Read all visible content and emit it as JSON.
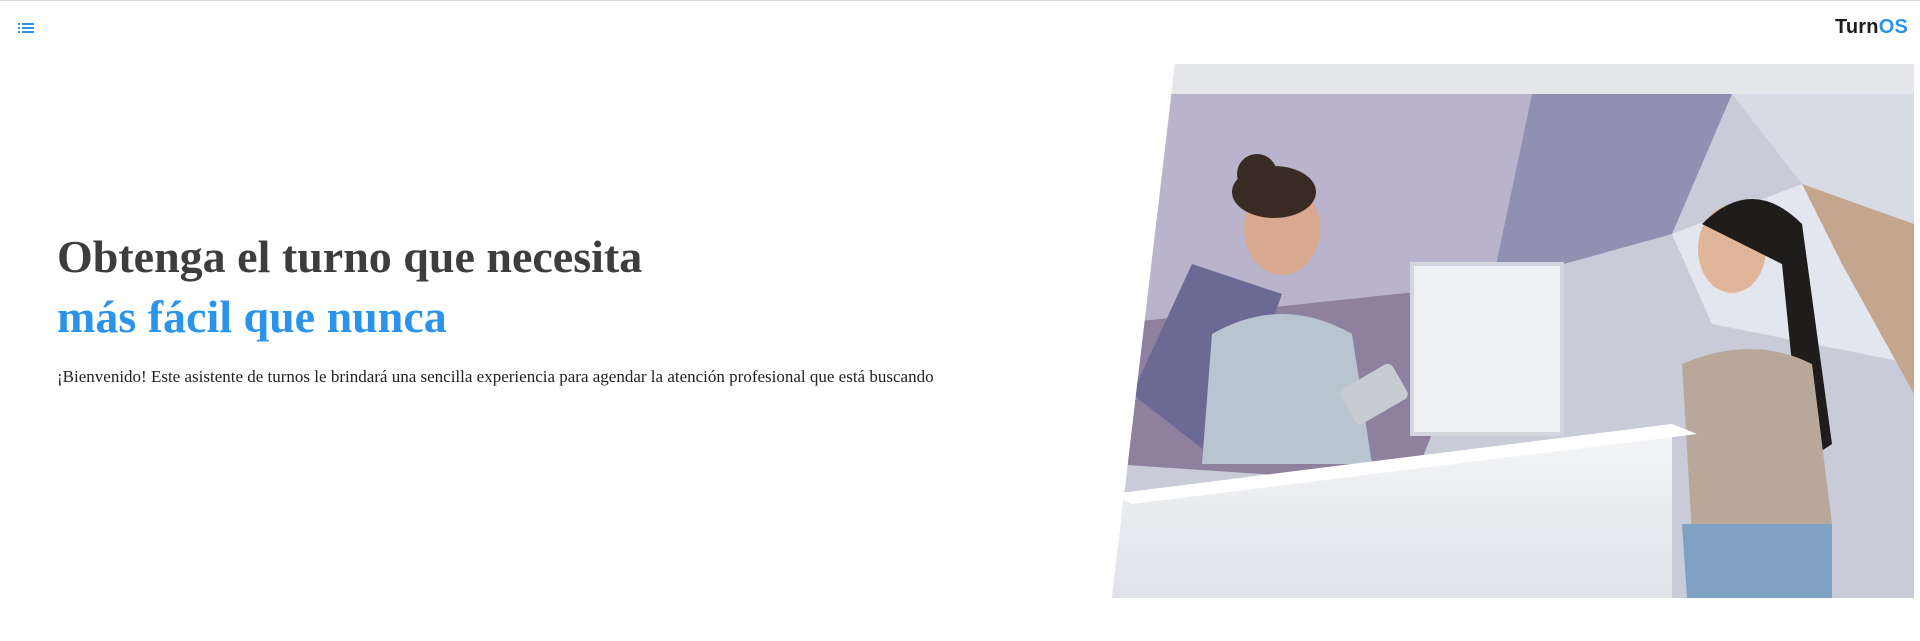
{
  "header": {
    "menu_icon": "list-icon",
    "brand_prefix": "Turn",
    "brand_suffix": "OS",
    "accent_color": "#2b93ea"
  },
  "hero": {
    "headline": "Obtenga el turno que necesita",
    "headline_accent": "más fácil que nunca",
    "intro": "¡Bienvenido! Este asistente de turnos le brindará una sencilla experiencia para agendar la atención profesional que está buscando",
    "image_subject": "receptionist-with-tablet-and-patient-at-counter"
  }
}
